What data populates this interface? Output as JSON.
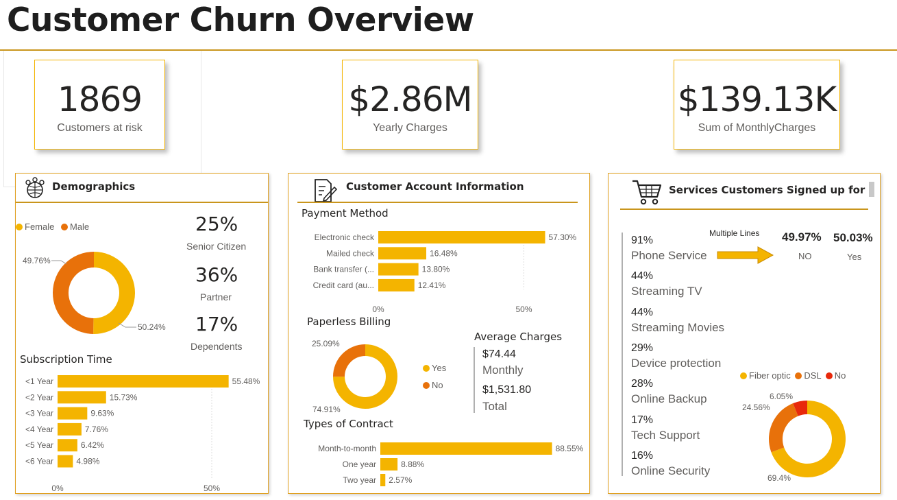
{
  "header": {
    "title": "Customer Churn Overview"
  },
  "kpis": [
    {
      "value": "1869",
      "label": "Customers at risk"
    },
    {
      "value": "$2.86M",
      "label": "Yearly Charges"
    },
    {
      "value": "$139.13K",
      "label": "Sum of MonthlyCharges"
    }
  ],
  "colors": {
    "gold": "#f4b400",
    "orange": "#e8710a",
    "red": "#e8290b",
    "accent_rule": "#c9951c"
  },
  "demographics": {
    "title": "Demographics",
    "icon": "people-globe-icon",
    "legend": [
      "Female",
      "Male"
    ],
    "stats": [
      {
        "value": "25%",
        "label": "Senior Citizen"
      },
      {
        "value": "36%",
        "label": "Partner"
      },
      {
        "value": "17%",
        "label": "Dependents"
      }
    ],
    "subscription_title": "Subscription Time"
  },
  "account": {
    "title": "Customer Account Information",
    "icon": "document-pen-icon",
    "payment_title": "Payment Method",
    "paperless_title": "Paperless Billing",
    "paperless_legend": [
      "Yes",
      "No"
    ],
    "avg_title": "Average Charges",
    "avg_monthly_value": "$74.44",
    "avg_monthly_label": "Monthly",
    "avg_total_value": "$1,531.80",
    "avg_total_label": "Total",
    "contract_title": "Types of Contract"
  },
  "services": {
    "title": "Services Customers Signed up for",
    "icon": "shopping-cart-icon",
    "items": [
      {
        "pct": "91%",
        "name": "Phone Service"
      },
      {
        "pct": "44%",
        "name": "Streaming TV"
      },
      {
        "pct": "44%",
        "name": "Streaming Movies"
      },
      {
        "pct": "29%",
        "name": "Device protection"
      },
      {
        "pct": "28%",
        "name": "Online Backup"
      },
      {
        "pct": "17%",
        "name": "Tech Support"
      },
      {
        "pct": "16%",
        "name": "Online Security"
      }
    ],
    "multiple_lines_label": "Multiple Lines",
    "multiple_no_value": "49.97%",
    "multiple_no_label": "NO",
    "multiple_yes_value": "50.03%",
    "multiple_yes_label": "Yes",
    "internet_legend": [
      "Fiber optic",
      "DSL",
      "No"
    ]
  },
  "chart_data": [
    {
      "id": "gender",
      "type": "pie",
      "donut": true,
      "categories": [
        "Female",
        "Male"
      ],
      "values": [
        50.24,
        49.76
      ],
      "labels": [
        "50.24%",
        "49.76%"
      ],
      "legend": "top-left"
    },
    {
      "id": "subscription",
      "type": "bar",
      "orientation": "horizontal",
      "title": "Subscription Time",
      "categories": [
        "<1 Year",
        "<2 Year",
        "<3 Year",
        "<4 Year",
        "<5 Year",
        "<6 Year"
      ],
      "values": [
        55.48,
        15.73,
        9.63,
        7.76,
        6.42,
        4.98
      ],
      "labels": [
        "55.48%",
        "15.73%",
        "9.63%",
        "7.76%",
        "6.42%",
        "4.98%"
      ],
      "xticks": [
        "0%",
        "50%"
      ],
      "xlim": [
        0,
        60
      ]
    },
    {
      "id": "payment",
      "type": "bar",
      "orientation": "horizontal",
      "title": "Payment Method",
      "categories": [
        "Electronic check",
        "Mailed check",
        "Bank transfer (...",
        "Credit card (au..."
      ],
      "values": [
        57.3,
        16.48,
        13.8,
        12.41
      ],
      "labels": [
        "57.30%",
        "16.48%",
        "13.80%",
        "12.41%"
      ],
      "xticks": [
        "0%",
        "50%"
      ],
      "xlim": [
        0,
        60
      ]
    },
    {
      "id": "paperless",
      "type": "pie",
      "donut": true,
      "title": "Paperless Billing",
      "categories": [
        "Yes",
        "No"
      ],
      "values": [
        74.91,
        25.09
      ],
      "labels": [
        "74.91%",
        "25.09%"
      ],
      "legend": "right"
    },
    {
      "id": "contract",
      "type": "bar",
      "orientation": "horizontal",
      "title": "Types of Contract",
      "categories": [
        "Month-to-month",
        "One year",
        "Two year"
      ],
      "values": [
        88.55,
        8.88,
        2.57
      ],
      "labels": [
        "88.55%",
        "8.88%",
        "2.57%"
      ],
      "xlim": [
        0,
        100
      ]
    },
    {
      "id": "internet",
      "type": "pie",
      "donut": true,
      "categories": [
        "Fiber optic",
        "DSL",
        "No"
      ],
      "values": [
        69.4,
        24.56,
        6.05
      ],
      "labels": [
        "69.4%",
        "24.56%",
        "6.05%"
      ],
      "legend": "top"
    }
  ]
}
